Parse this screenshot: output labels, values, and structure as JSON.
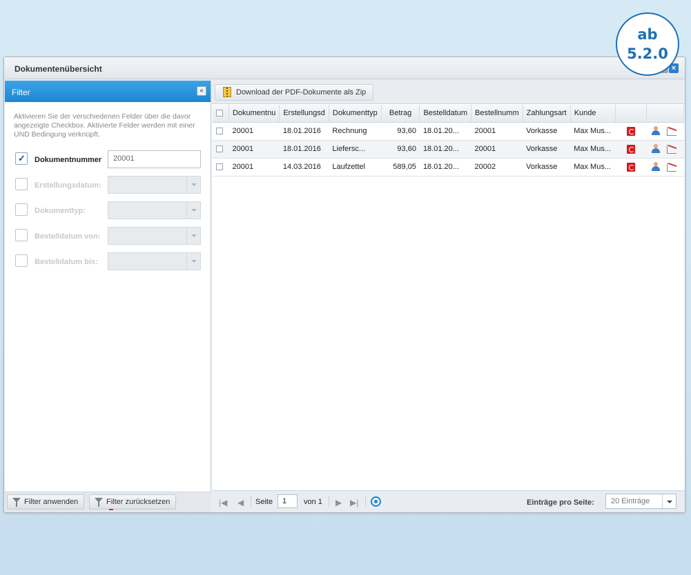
{
  "badge": {
    "line1": "ab",
    "line2": "5.2.0"
  },
  "window": {
    "title": "Dokumentenübersicht",
    "max_icon": "maximize-icon",
    "close_icon": "×"
  },
  "filter": {
    "title": "Filter",
    "collapse": "«",
    "description": "Aktivieren Sie der verschiedenen Felder über die davor angezeigte Checkbox. Aktivierte Felder werden mit einer UND Bedingung verknüpft.",
    "fields": [
      {
        "label": "Dokumentnummer",
        "checked": true,
        "value": "20001"
      },
      {
        "label": "Erstellungsdatum:",
        "checked": false,
        "value": ""
      },
      {
        "label": "Dokumenttyp:",
        "checked": false,
        "value": ""
      },
      {
        "label": "Bestelldatum von:",
        "checked": false,
        "value": ""
      },
      {
        "label": "Bestelldatum bis:",
        "checked": false,
        "value": ""
      }
    ],
    "apply_label": "Filter anwenden",
    "reset_label": "Filter zurücksetzen"
  },
  "toolbar": {
    "zip_label": "Download der PDF-Dokumente als Zip"
  },
  "grid": {
    "columns": [
      "Dokumentnu",
      "Erstellungsd",
      "Dokumenttyp",
      "Betrag",
      "Bestelldatum",
      "Bestellnumm",
      "Zahlungsart",
      "Kunde"
    ],
    "rows": [
      {
        "nr": "20001",
        "created": "18.01.2016",
        "type": "Rechnung",
        "amount": "93,60",
        "order_date": "18.01.20...",
        "order_nr": "20001",
        "payment": "Vorkasse",
        "customer": "Max Mus..."
      },
      {
        "nr": "20001",
        "created": "18.01.2016",
        "type": "Liefersc...",
        "amount": "93,60",
        "order_date": "18.01.20...",
        "order_nr": "20001",
        "payment": "Vorkasse",
        "customer": "Max Mus..."
      },
      {
        "nr": "20001",
        "created": "14.03.2016",
        "type": "Laufzettel",
        "amount": "589,05",
        "order_date": "18.01.20...",
        "order_nr": "20002",
        "payment": "Vorkasse",
        "customer": "Max Mus..."
      }
    ]
  },
  "pager": {
    "page_label": "Seite",
    "page_value": "1",
    "of_label": "von 1",
    "per_page_label": "Einträge pro Seite:",
    "per_page_value": "20 Einträge"
  },
  "colors": {
    "accent": "#1f86d2",
    "pdf": "#d11d1d"
  }
}
